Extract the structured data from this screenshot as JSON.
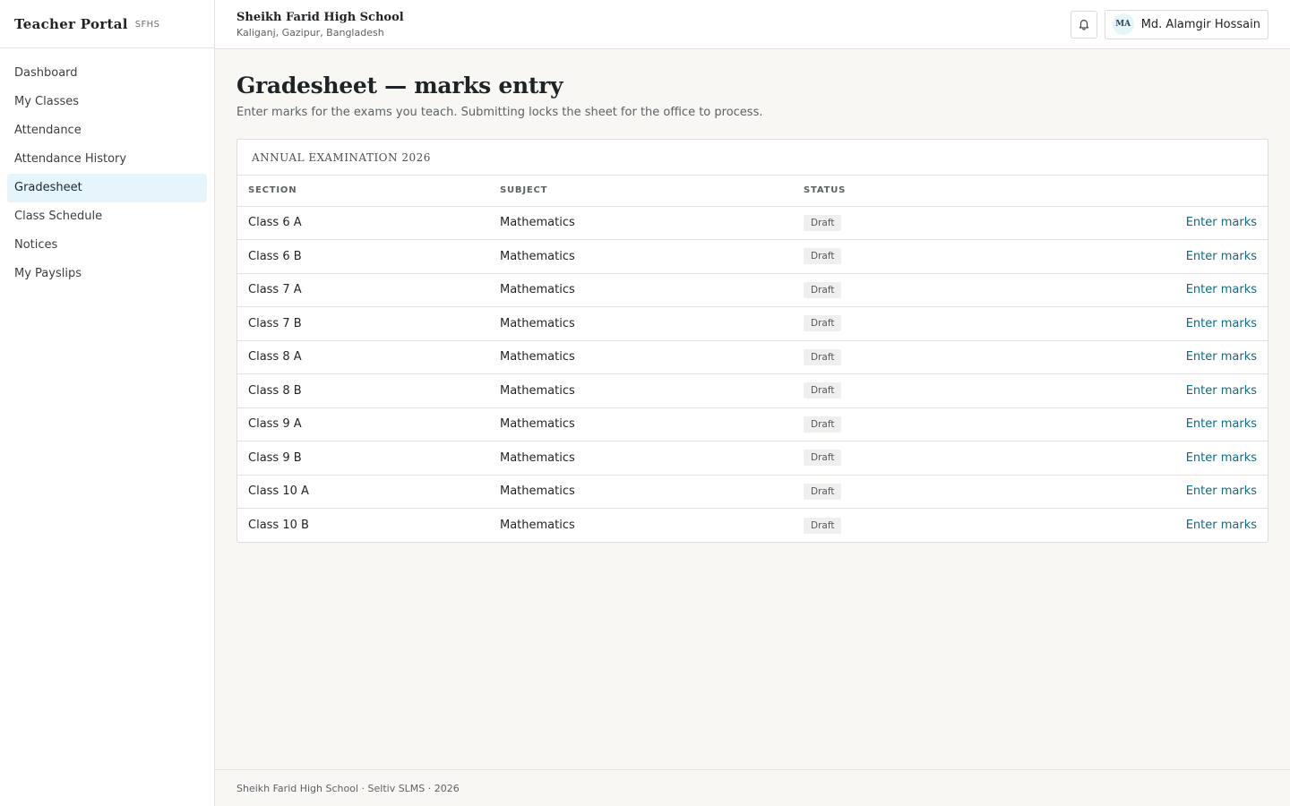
{
  "sidebar": {
    "brand": "Teacher Portal",
    "brand_code": "SFHS",
    "items": [
      {
        "label": "Dashboard",
        "active": false
      },
      {
        "label": "My Classes",
        "active": false
      },
      {
        "label": "Attendance",
        "active": false
      },
      {
        "label": "Attendance History",
        "active": false
      },
      {
        "label": "Gradesheet",
        "active": true
      },
      {
        "label": "Class Schedule",
        "active": false
      },
      {
        "label": "Notices",
        "active": false
      },
      {
        "label": "My Payslips",
        "active": false
      }
    ]
  },
  "header": {
    "school_name": "Sheikh Farid High School",
    "location": "Kaliganj, Gazipur, Bangladesh",
    "bell_icon": "bell-icon",
    "user": {
      "initials": "MA",
      "name": "Md. Alamgir Hossain"
    }
  },
  "main": {
    "title": "Gradesheet — marks entry",
    "subtitle": "Enter marks for the exams you teach. Submitting locks the sheet for the office to process.",
    "card": {
      "heading": "ANNUAL EXAMINATION 2026",
      "columns": [
        "SECTION",
        "SUBJECT",
        "STATUS"
      ],
      "rows": [
        {
          "section": "Class 6 A",
          "subject": "Mathematics",
          "status": "Draft",
          "action": "Enter marks"
        },
        {
          "section": "Class 6 B",
          "subject": "Mathematics",
          "status": "Draft",
          "action": "Enter marks"
        },
        {
          "section": "Class 7 A",
          "subject": "Mathematics",
          "status": "Draft",
          "action": "Enter marks"
        },
        {
          "section": "Class 7 B",
          "subject": "Mathematics",
          "status": "Draft",
          "action": "Enter marks"
        },
        {
          "section": "Class 8 A",
          "subject": "Mathematics",
          "status": "Draft",
          "action": "Enter marks"
        },
        {
          "section": "Class 8 B",
          "subject": "Mathematics",
          "status": "Draft",
          "action": "Enter marks"
        },
        {
          "section": "Class 9 A",
          "subject": "Mathematics",
          "status": "Draft",
          "action": "Enter marks"
        },
        {
          "section": "Class 9 B",
          "subject": "Mathematics",
          "status": "Draft",
          "action": "Enter marks"
        },
        {
          "section": "Class 10 A",
          "subject": "Mathematics",
          "status": "Draft",
          "action": "Enter marks"
        },
        {
          "section": "Class 10 B",
          "subject": "Mathematics",
          "status": "Draft",
          "action": "Enter marks"
        }
      ]
    }
  },
  "footer": {
    "text": "Sheikh Farid High School · Seltiv SLMS · 2026"
  },
  "colors": {
    "accent": "#0f6a82",
    "active_nav_bg": "#e6f5fb",
    "page_bg": "#f8f7f3"
  }
}
